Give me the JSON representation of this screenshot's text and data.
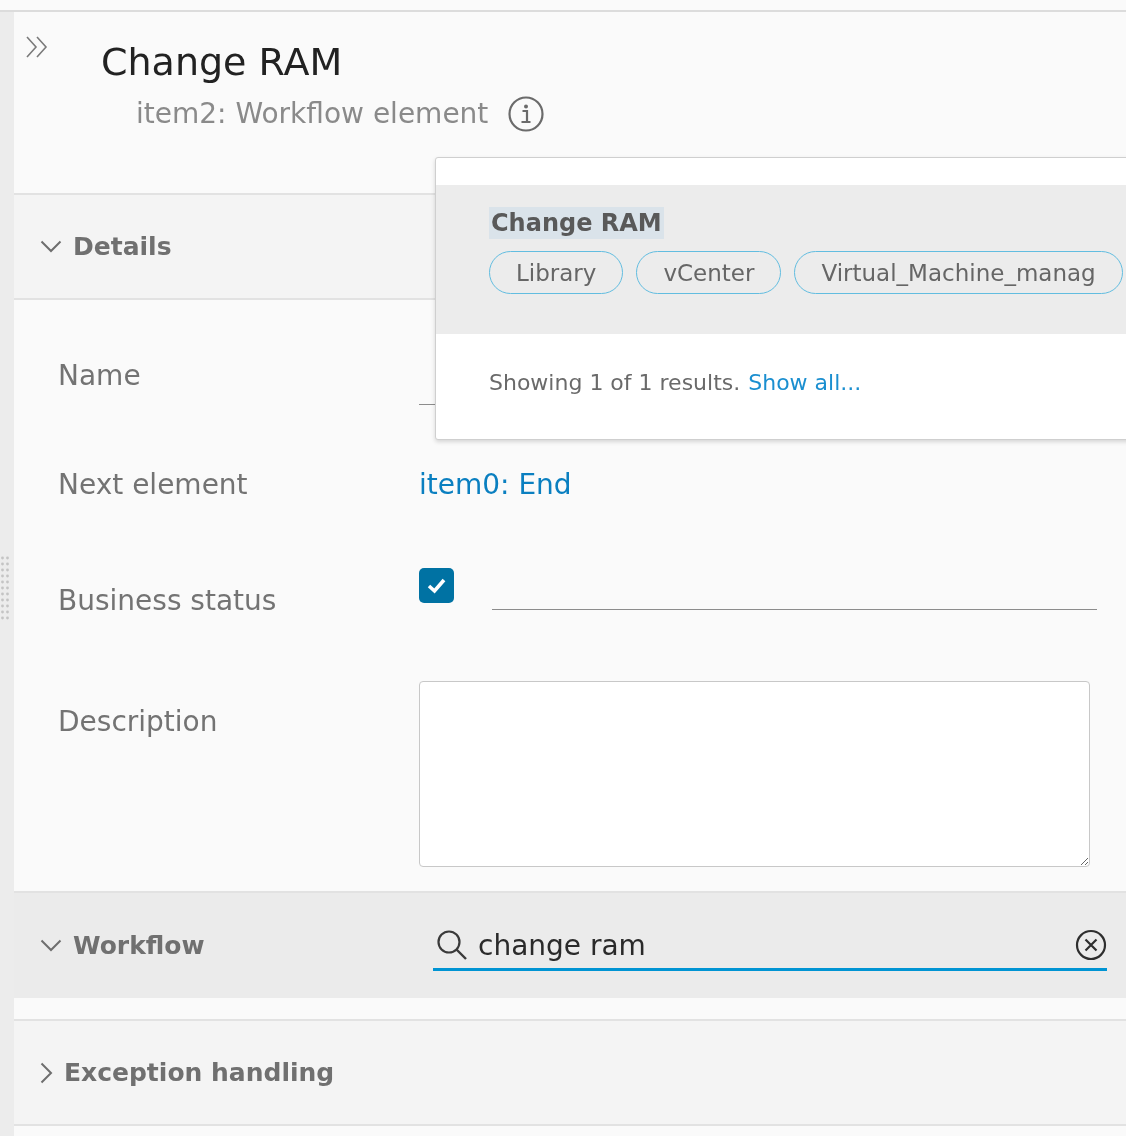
{
  "header": {
    "title": "Change RAM",
    "subtitle": "item2: Workflow element"
  },
  "sections": [
    {
      "kind": "form",
      "title": "Details",
      "expanded": true,
      "active": false,
      "fields": [
        {
          "kind": "text",
          "label": "Name"
        },
        {
          "kind": "link",
          "label": "Next element",
          "value": "item0: End"
        },
        {
          "kind": "checkbox",
          "label": "Business status",
          "checked": true
        },
        {
          "kind": "textarea",
          "label": "Description"
        }
      ]
    },
    {
      "kind": "search",
      "title": "Workflow",
      "expanded": true,
      "active": true,
      "search": {
        "value": "change ram"
      }
    },
    {
      "kind": "plain",
      "title": "Exception handling",
      "expanded": false,
      "active": false
    }
  ],
  "dropdown": {
    "results": [
      {
        "name": "Change RAM",
        "selected": true,
        "name_highlighted": true,
        "tags": [
          "Library",
          "vCenter",
          "Virtual_Machine_manag"
        ]
      }
    ],
    "footer": "Showing 1 of 1 results.",
    "link": "Show all..."
  }
}
